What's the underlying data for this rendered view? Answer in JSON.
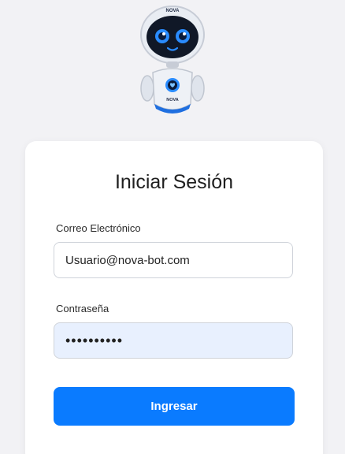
{
  "logo": {
    "brand_text_top": "NOVA",
    "brand_text_body": "NOVA"
  },
  "login": {
    "title": "Iniciar Sesión",
    "email_label": "Correo Electrónico",
    "email_value": "Usuario@nova-bot.com",
    "password_label": "Contraseña",
    "password_value": "••••••••••",
    "submit_label": "Ingresar"
  },
  "colors": {
    "background": "#f2f2f5",
    "card": "#ffffff",
    "accent": "#0a7bff",
    "autofill": "#e8f0fe"
  }
}
